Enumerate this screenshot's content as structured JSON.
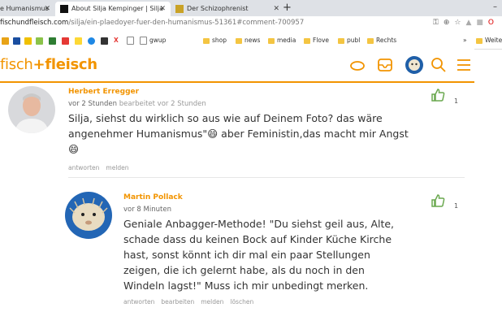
{
  "browser": {
    "tabs": [
      {
        "title": "e Humanismus"
      },
      {
        "title": "About Silja Kempinger | Silja"
      },
      {
        "title": "Der Schizophrenist"
      }
    ],
    "new_tab": "+",
    "window_minimize": "–",
    "url": {
      "host": "fischundfleisch.com",
      "path": "/silja/ein-plaedoyer-fuer-den-humanismus-51361#comment-700957"
    },
    "bookmarks": [
      "gwup",
      "shop",
      "news",
      "media",
      "Flove",
      "publ",
      "Rechts"
    ],
    "bookmarks_overflow": "»",
    "bookmarks_other": "Weite"
  },
  "site": {
    "logo_part1": "fisch",
    "logo_plus": "+",
    "logo_part2": "fleisch"
  },
  "comments": [
    {
      "author": "Herbert Erregger",
      "time": "vor 2 Stunden",
      "edited": "bearbeitet vor 2 Stunden",
      "lines": [
        "Silja, siehst du wirklich so aus wie auf Deinem Foto? das wäre",
        "angenehmer Humanismus\"😄 aber Feministin,das macht mir Angst😄"
      ],
      "actions": [
        "antworten",
        "melden"
      ],
      "likes": "1"
    },
    {
      "author": "Martin Pollack",
      "time": "vor 8 Minuten",
      "lines": [
        "Geniale Anbagger-Methode! \"Du siehst geil aus, Alte,",
        "schade dass du keinen Bock auf Kinder Küche Kirche",
        "hast, sonst könnt ich dir mal ein paar Stellungen",
        "zeigen, die ich gelernt habe, als du noch in den",
        "Windeln lagst!\" Muss ich mir unbedingt merken."
      ],
      "actions": [
        "antworten",
        "bearbeiten",
        "melden",
        "löschen"
      ],
      "likes": "1"
    }
  ],
  "colors": {
    "brand": "#f29400",
    "like": "#6aa84f"
  }
}
